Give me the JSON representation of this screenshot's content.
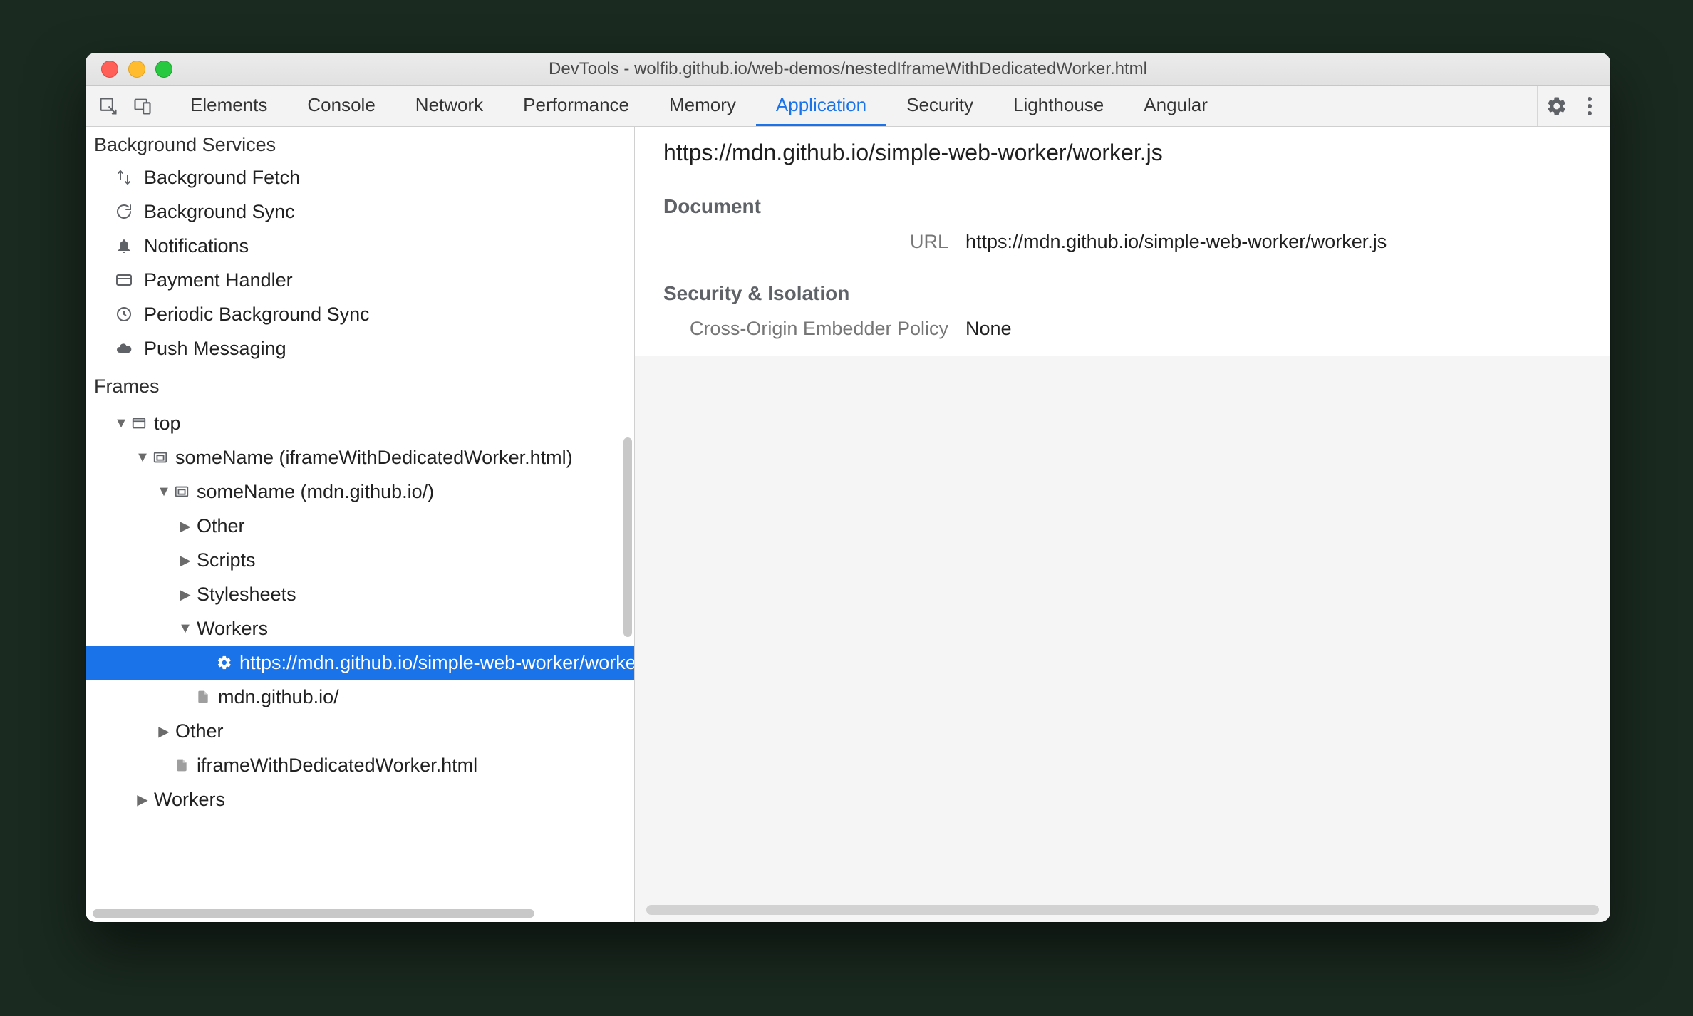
{
  "window": {
    "title": "DevTools - wolfib.github.io/web-demos/nestedIframeWithDedicatedWorker.html"
  },
  "tabs": {
    "items": [
      "Elements",
      "Console",
      "Network",
      "Performance",
      "Memory",
      "Application",
      "Security",
      "Lighthouse",
      "Angular"
    ],
    "active_index": 5
  },
  "sidebar": {
    "section_bg": "Background Services",
    "bg_items": [
      {
        "icon": "arrows",
        "label": "Background Fetch"
      },
      {
        "icon": "sync",
        "label": "Background Sync"
      },
      {
        "icon": "bell",
        "label": "Notifications"
      },
      {
        "icon": "card",
        "label": "Payment Handler"
      },
      {
        "icon": "clock",
        "label": "Periodic Background Sync"
      },
      {
        "icon": "cloud",
        "label": "Push Messaging"
      }
    ],
    "section_frames": "Frames",
    "tree": {
      "top": "top",
      "f1": "someName (iframeWithDedicatedWorker.html)",
      "f2": "someName (mdn.github.io/)",
      "other": "Other",
      "scripts": "Scripts",
      "stylesheets": "Stylesheets",
      "workers": "Workers",
      "worker": "https://mdn.github.io/simple-web-worker/worker.js",
      "doc": "mdn.github.io/",
      "other2": "Other",
      "ifr": "iframeWithDedicatedWorker.html",
      "workers2": "Workers"
    }
  },
  "main": {
    "title": "https://mdn.github.io/simple-web-worker/worker.js",
    "doc_section": "Document",
    "url_label": "URL",
    "url_value": "https://mdn.github.io/simple-web-worker/worker.js",
    "sec_section": "Security & Isolation",
    "coep_label": "Cross-Origin Embedder Policy",
    "coep_value": "None"
  }
}
